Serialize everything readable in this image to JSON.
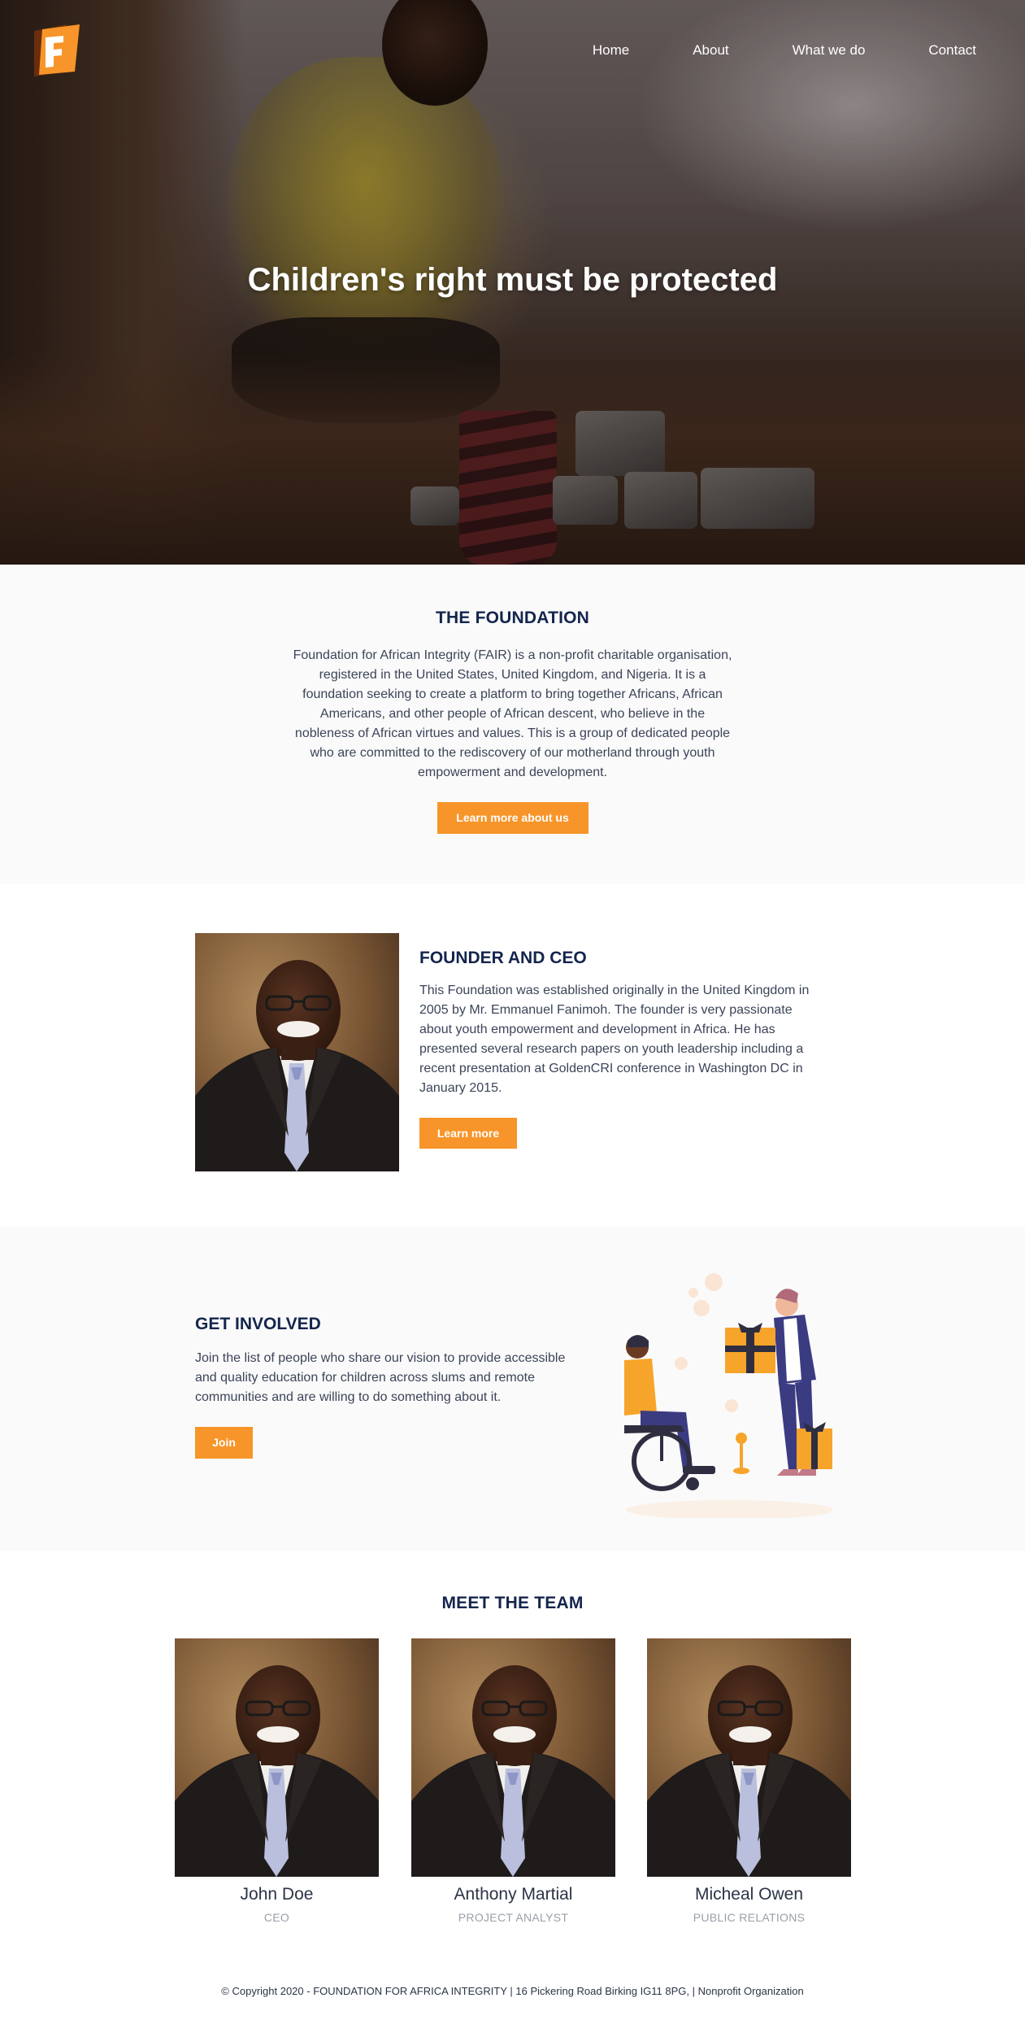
{
  "nav": {
    "items": [
      "Home",
      "About",
      "What we do",
      "Contact"
    ]
  },
  "logo": {
    "letter": "F",
    "brand_color": "#f7952a",
    "dark_color": "#6b2d0c"
  },
  "hero": {
    "title": "Children's right must be protected"
  },
  "foundation": {
    "heading": "THE FOUNDATION",
    "body": "Foundation for African Integrity (FAIR) is a non-profit charitable organisation, registered in the United States, United Kingdom, and Nigeria. It is a foundation seeking to create a platform to bring together Africans, African Americans, and other people of African descent, who believe in the nobleness of African virtues and values. This is a group of dedicated people who are committed to the rediscovery of our motherland through youth empowerment and development.",
    "button": "Learn more about us"
  },
  "founder": {
    "heading": "FOUNDER AND CEO",
    "body": "This Foundation was established originally in the United Kingdom in 2005 by Mr. Emmanuel Fanimoh. The founder is very passionate about youth empowerment and development in Africa. He has presented several research papers on youth leadership including a recent presentation at GoldenCRI conference in Washington DC in January 2015.",
    "button": "Learn more"
  },
  "involved": {
    "heading": "GET INVOLVED",
    "body": "Join the list of people who share our vision to provide accessible and quality education for children across slums and remote communities and are willing to do something about it.",
    "button": "Join"
  },
  "team": {
    "heading": "MEET THE TEAM",
    "members": [
      {
        "name": "John Doe",
        "role": "CEO"
      },
      {
        "name": "Anthony Martial",
        "role": "PROJECT ANALYST"
      },
      {
        "name": "Micheal Owen",
        "role": "PUBLIC RELATIONS"
      }
    ]
  },
  "footer": {
    "text": "© Copyright 2020 - FOUNDATION FOR AFRICA INTEGRITY | 16 Pickering Road Birking IG11 8PG, | Nonprofit Organization"
  },
  "colors": {
    "accent": "#f7952a",
    "heading": "#14254d",
    "section_bg": "#fafafa"
  }
}
